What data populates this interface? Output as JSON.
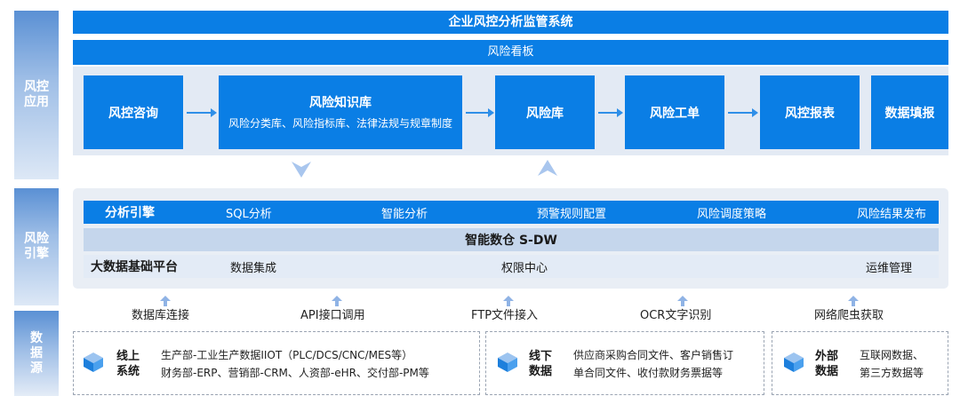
{
  "sidebar": {
    "app_line1": "风控",
    "app_line2": "应用",
    "engine_line1": "风险",
    "engine_line2": "引擎",
    "source_line1": "数",
    "source_line2": "据",
    "source_line3": "源"
  },
  "header": {
    "title": "企业风控分析监管系统",
    "dashboard": "风险看板"
  },
  "modules": {
    "consult": "风控咨询",
    "knowledge_title": "风险知识库",
    "knowledge_sub": "风险分类库、风险指标库、法律法规与规章制度",
    "risk_db": "风险库",
    "ticket": "风险工单",
    "report": "风控报表",
    "fill": "数据填报"
  },
  "engine": {
    "label": "分析引擎",
    "items": [
      "SQL分析",
      "智能分析",
      "预警规则配置",
      "风险调度策略",
      "风险结果发布"
    ],
    "warehouse": "智能数仓 S-DW",
    "platform_label": "大数据基础平台",
    "platform_items": [
      "数据集成",
      "权限中心",
      "运维管理"
    ]
  },
  "connectors": [
    "数据库连接",
    "API接口调用",
    "FTP文件接入",
    "OCR文字识别",
    "网络爬虫获取"
  ],
  "sources": {
    "online_title1": "线上",
    "online_title2": "系统",
    "online_line1": "生产部-工业生产数据IIOT（PLC/DCS/CNC/MES等）",
    "online_line2": "财务部-ERP、营销部-CRM、人资部-eHR、交付部-PM等",
    "offline_title1": "线下",
    "offline_title2": "数据",
    "offline_line1": "供应商采购合同文件、客户销售订",
    "offline_line2": "单合同文件、收付款财务票据等",
    "external_title1": "外部",
    "external_title2": "数据",
    "external_line1": "互联网数据、",
    "external_line2": "第三方数据等"
  },
  "colors": {
    "primary": "#0a7ee5",
    "engine_bg": "#e9eef5",
    "dark_band": "#0c5fb6"
  },
  "icons": {
    "up": "up-arrow-icon",
    "down": "down-arrow-icon",
    "source": "cube-icon"
  }
}
